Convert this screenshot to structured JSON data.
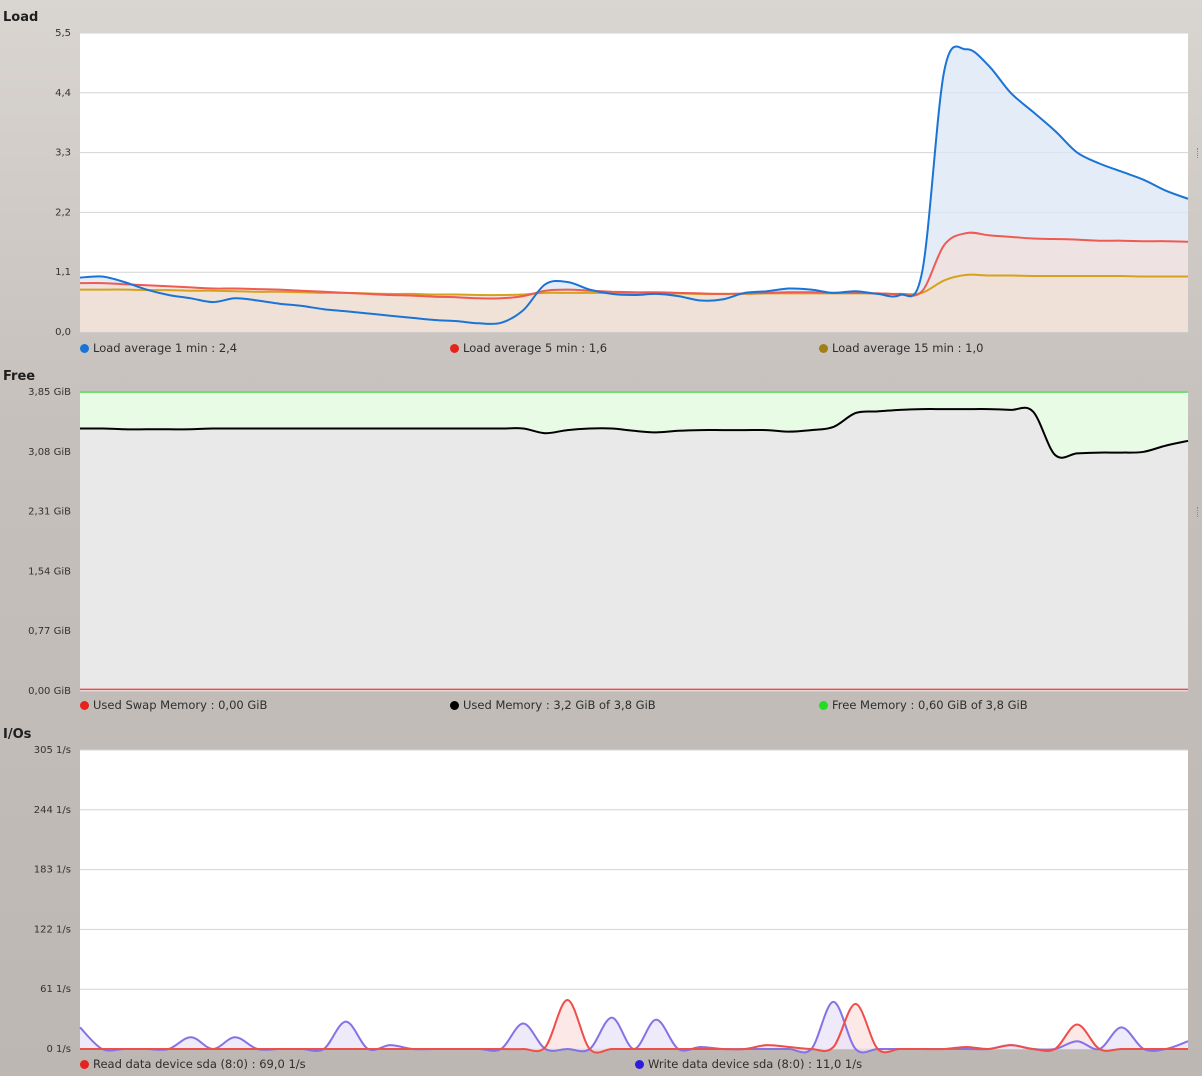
{
  "panels": [
    {
      "id": "load",
      "title": "Load",
      "chart_data": {
        "type": "area",
        "title": "Load",
        "x": [
          0,
          2,
          4,
          6,
          8,
          10,
          12,
          14,
          16,
          18,
          20,
          22,
          24,
          26,
          28,
          30,
          32,
          34,
          36,
          38,
          40,
          42,
          44,
          46,
          48,
          50,
          52,
          54,
          56,
          58,
          60,
          62,
          64,
          66,
          68,
          70,
          72,
          74,
          76,
          78,
          80,
          82,
          84,
          86,
          88,
          90,
          92,
          94,
          96,
          98,
          100
        ],
        "ylim": [
          0,
          5.5
        ],
        "yticks": [
          "0,0",
          "1,1",
          "2,2",
          "3,3",
          "4,4",
          "5,5"
        ],
        "grid": true,
        "legend_position": "bottom",
        "series": [
          {
            "name": "Load average 1 min",
            "current": "2,4",
            "color": "#1a74d6",
            "fill": "#dbe7f4",
            "values": [
              1.0,
              1.02,
              0.92,
              0.78,
              0.68,
              0.62,
              0.55,
              0.62,
              0.58,
              0.52,
              0.48,
              0.42,
              0.38,
              0.34,
              0.3,
              0.26,
              0.22,
              0.2,
              0.16,
              0.17,
              0.4,
              0.88,
              0.92,
              0.78,
              0.7,
              0.68,
              0.7,
              0.66,
              0.58,
              0.6,
              0.72,
              0.75,
              0.8,
              0.78,
              0.72,
              0.75,
              0.7,
              0.68,
              1.1,
              4.8,
              5.2,
              4.9,
              4.4,
              4.05,
              3.7,
              3.3,
              3.1,
              2.95,
              2.8,
              2.6,
              2.45
            ]
          },
          {
            "name": "Load average 5 min",
            "current": "1,6",
            "color": "#ef5a52",
            "fill": "#f2dedb",
            "values": [
              0.9,
              0.9,
              0.88,
              0.86,
              0.84,
              0.82,
              0.8,
              0.8,
              0.79,
              0.78,
              0.76,
              0.74,
              0.72,
              0.7,
              0.68,
              0.67,
              0.65,
              0.64,
              0.62,
              0.62,
              0.66,
              0.76,
              0.78,
              0.76,
              0.74,
              0.73,
              0.73,
              0.72,
              0.71,
              0.7,
              0.71,
              0.72,
              0.73,
              0.73,
              0.72,
              0.72,
              0.71,
              0.7,
              0.75,
              1.6,
              1.82,
              1.78,
              1.75,
              1.72,
              1.71,
              1.7,
              1.68,
              1.68,
              1.67,
              1.67,
              1.66
            ]
          },
          {
            "name": "Load average 15 min",
            "current": "1,0",
            "color": "#d4a21c",
            "fill": "#efe0d4",
            "values": [
              0.78,
              0.78,
              0.78,
              0.77,
              0.77,
              0.76,
              0.76,
              0.75,
              0.74,
              0.74,
              0.73,
              0.72,
              0.72,
              0.71,
              0.7,
              0.7,
              0.69,
              0.69,
              0.68,
              0.68,
              0.69,
              0.72,
              0.72,
              0.72,
              0.72,
              0.71,
              0.71,
              0.71,
              0.7,
              0.7,
              0.7,
              0.71,
              0.71,
              0.71,
              0.71,
              0.71,
              0.71,
              0.7,
              0.72,
              0.95,
              1.05,
              1.04,
              1.04,
              1.03,
              1.03,
              1.03,
              1.03,
              1.03,
              1.02,
              1.02,
              1.02
            ]
          }
        ]
      },
      "legend": [
        {
          "label": "Load average 1 min : 2,4",
          "color": "#1a74d6"
        },
        {
          "label": "Load average 5 min : 1,6",
          "color": "#e5231c"
        },
        {
          "label": "Load average 15 min : 1,0",
          "color": "#a08014"
        }
      ]
    },
    {
      "id": "free",
      "title": "Free",
      "chart_data": {
        "type": "area",
        "title": "Free",
        "x": [
          0,
          2,
          4,
          6,
          8,
          10,
          12,
          14,
          16,
          18,
          20,
          22,
          24,
          26,
          28,
          30,
          32,
          34,
          36,
          38,
          40,
          42,
          44,
          46,
          48,
          50,
          52,
          54,
          56,
          58,
          60,
          62,
          64,
          66,
          68,
          70,
          72,
          74,
          76,
          78,
          80,
          82,
          84,
          86,
          88,
          90,
          92,
          94,
          96,
          98,
          100
        ],
        "ylim": [
          0,
          3.85
        ],
        "yticks": [
          "0,00 GiB",
          "0,77 GiB",
          "1,54 GiB",
          "2,31 GiB",
          "3,08 GiB",
          "3,85 GiB"
        ],
        "grid": true,
        "legend_position": "bottom",
        "capacity": 3.85,
        "series": [
          {
            "name": "Used Swap Memory",
            "current": "0,00 GiB",
            "color": "#ef4a44",
            "values": [
              0.02,
              0.02,
              0.02,
              0.02,
              0.02,
              0.02,
              0.02,
              0.02,
              0.02,
              0.02,
              0.02,
              0.02,
              0.02,
              0.02,
              0.02,
              0.02,
              0.02,
              0.02,
              0.02,
              0.02,
              0.02,
              0.02,
              0.02,
              0.02,
              0.02,
              0.02,
              0.02,
              0.02,
              0.02,
              0.02,
              0.02,
              0.02,
              0.02,
              0.02,
              0.02,
              0.02,
              0.02,
              0.02,
              0.02,
              0.02,
              0.02,
              0.02,
              0.02,
              0.02,
              0.02,
              0.02,
              0.02,
              0.02,
              0.02,
              0.02,
              0.02
            ]
          },
          {
            "name": "Used Memory",
            "current": "3,2 GiB of 3,8 GiB",
            "color": "#000000",
            "fill": "#e9e9e9",
            "values": [
              3.38,
              3.38,
              3.37,
              3.37,
              3.37,
              3.37,
              3.38,
              3.38,
              3.38,
              3.38,
              3.38,
              3.38,
              3.38,
              3.38,
              3.38,
              3.38,
              3.38,
              3.38,
              3.38,
              3.38,
              3.38,
              3.32,
              3.36,
              3.38,
              3.38,
              3.35,
              3.33,
              3.35,
              3.36,
              3.36,
              3.36,
              3.36,
              3.34,
              3.36,
              3.4,
              3.58,
              3.6,
              3.62,
              3.63,
              3.63,
              3.63,
              3.63,
              3.62,
              3.6,
              3.04,
              3.06,
              3.07,
              3.07,
              3.08,
              3.16,
              3.22
            ]
          },
          {
            "name": "Free Memory",
            "current": "0,60 GiB of 3,8 GiB",
            "color": "#6fe06f",
            "fill": "#e8fbe5",
            "values": [
              3.82,
              3.82,
              3.82,
              3.82,
              3.82,
              3.82,
              3.82,
              3.82,
              3.82,
              3.82,
              3.82,
              3.82,
              3.82,
              3.82,
              3.82,
              3.82,
              3.82,
              3.82,
              3.82,
              3.82,
              3.82,
              3.82,
              3.82,
              3.82,
              3.82,
              3.82,
              3.82,
              3.82,
              3.82,
              3.82,
              3.82,
              3.82,
              3.82,
              3.82,
              3.82,
              3.82,
              3.82,
              3.82,
              3.82,
              3.82,
              3.82,
              3.82,
              3.82,
              3.82,
              3.82,
              3.82,
              3.82,
              3.82,
              3.82,
              3.82,
              3.82
            ]
          }
        ]
      },
      "legend": [
        {
          "label": "Used Swap Memory : 0,00 GiB",
          "color": "#e5231c"
        },
        {
          "label": "Used Memory : 3,2 GiB of 3,8 GiB",
          "color": "#000000"
        },
        {
          "label": "Free Memory : 0,60 GiB of 3,8 GiB",
          "color": "#22dd22"
        }
      ]
    },
    {
      "id": "ios",
      "title": "I/Os",
      "chart_data": {
        "type": "area",
        "title": "I/Os",
        "x": [
          0,
          2,
          4,
          6,
          8,
          10,
          12,
          14,
          16,
          18,
          20,
          22,
          24,
          26,
          28,
          30,
          32,
          34,
          36,
          38,
          40,
          42,
          44,
          46,
          48,
          50,
          52,
          54,
          56,
          58,
          60,
          62,
          64,
          66,
          68,
          70,
          72,
          74,
          76,
          78,
          80,
          82,
          84,
          86,
          88,
          90,
          92,
          94,
          96,
          98,
          100
        ],
        "ylim": [
          0,
          305
        ],
        "yticks": [
          "0 1/s",
          "61 1/s",
          "122 1/s",
          "183 1/s",
          "244 1/s",
          "305 1/s"
        ],
        "grid": true,
        "legend_position": "bottom",
        "series": [
          {
            "name": "Read data device sda (8:0)",
            "current": "69,0 1/s",
            "color": "#ee4f4a",
            "fill": "#f9e0df",
            "values": [
              0,
              0,
              0,
              0,
              0,
              0,
              0,
              0,
              0,
              0,
              0,
              0,
              0,
              0,
              0,
              0,
              0,
              0,
              0,
              0,
              0,
              2,
              50,
              0,
              0,
              0,
              0,
              0,
              0,
              0,
              0,
              4,
              2,
              0,
              2,
              46,
              0,
              0,
              0,
              0,
              2,
              0,
              4,
              0,
              0,
              25,
              0,
              0,
              0,
              0,
              0
            ]
          },
          {
            "name": "Write data device sda (8:0)",
            "current": "11,0 1/s",
            "color": "#8472e6",
            "fill": "#e9e3f7",
            "values": [
              22,
              0,
              0,
              0,
              0,
              12,
              0,
              12,
              0,
              0,
              0,
              0,
              28,
              0,
              4,
              0,
              0,
              0,
              0,
              0,
              26,
              0,
              0,
              0,
              32,
              0,
              30,
              0,
              2,
              0,
              0,
              0,
              0,
              0,
              48,
              0,
              0,
              0,
              0,
              0,
              0,
              0,
              4,
              0,
              0,
              8,
              0,
              22,
              0,
              0,
              8
            ]
          }
        ]
      },
      "legend": [
        {
          "label": "Read data device sda (8:0) : 69,0 1/s",
          "color": "#e5231c"
        },
        {
          "label": "Write data device sda (8:0) : 11,0 1/s",
          "color": "#2a1de0"
        }
      ]
    }
  ]
}
